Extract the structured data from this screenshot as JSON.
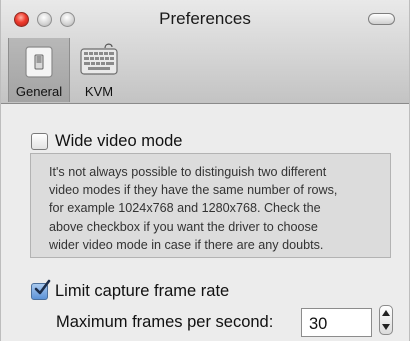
{
  "window": {
    "title": "Preferences"
  },
  "toolbar": {
    "items": [
      {
        "label": "General",
        "icon": "light-switch-icon",
        "selected": true
      },
      {
        "label": "KVM",
        "icon": "keyboard-icon",
        "selected": false
      }
    ]
  },
  "general": {
    "wide_video": {
      "label": "Wide video mode",
      "checked": false,
      "description": [
        "It's not always possible to distinguish two different",
        "video modes if they have the same number of rows,",
        "for example 1024x768 and 1280x768. Check the",
        "above checkbox if you want the driver to choose",
        "wider video mode in case if there are any doubts."
      ]
    },
    "limit_frame_rate": {
      "label": "Limit capture frame rate",
      "checked": true
    },
    "max_fps": {
      "label": "Maximum frames per second:",
      "value": "30"
    }
  },
  "colors": {
    "close_button": "#ef3b2e",
    "checkbox_checked": "#5d93d8",
    "panel_background": "#ececec"
  }
}
